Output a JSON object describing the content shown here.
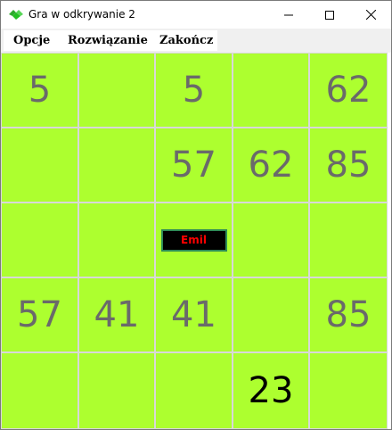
{
  "window": {
    "title": "Gra w odkrywanie 2",
    "icon": "game-app-icon"
  },
  "menu": {
    "items": [
      "Opcje",
      "Rozwiązanie",
      "Zakończ"
    ]
  },
  "board": {
    "cell_color": "#adff2f",
    "hidden_number_color": "#6a6a6a",
    "revealed_number_color": "#000000",
    "rows": [
      [
        "5",
        "",
        "5",
        "",
        "62"
      ],
      [
        "",
        "",
        "57",
        "62",
        "85"
      ],
      [
        "",
        "",
        "",
        "",
        ""
      ],
      [
        "57",
        "41",
        "41",
        "",
        "85"
      ],
      [
        "",
        "",
        "",
        "23",
        ""
      ]
    ],
    "revealed_cell": "23",
    "player_label": "Emil",
    "player_label_color": "#ff0000"
  }
}
